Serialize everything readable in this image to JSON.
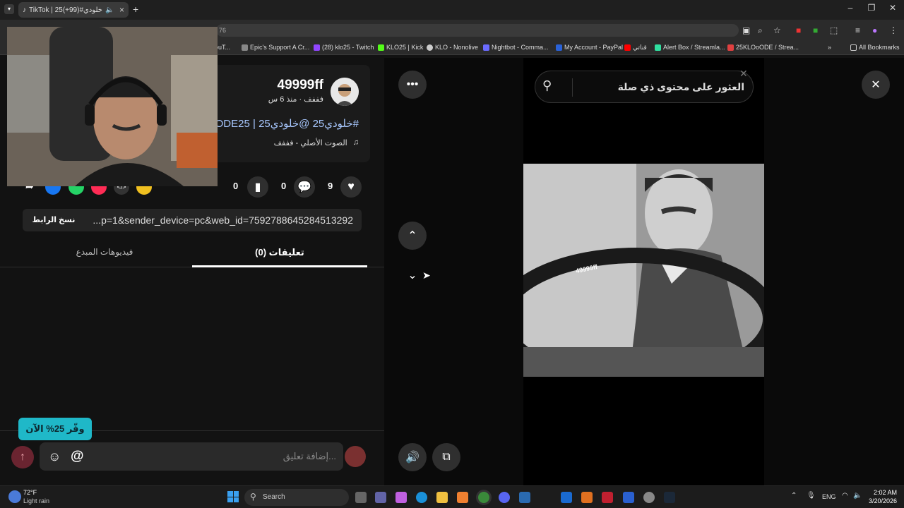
{
  "browser": {
    "tab_title": "TikTok | 25خلودي#(99+)",
    "tab_badge": "",
    "address_fragment": "76",
    "bookmarks": [
      {
        "label": "ouT...",
        "color": "#888"
      },
      {
        "label": "Epic's Support A Cr...",
        "color": "#888"
      },
      {
        "label": "(28) klo25 - Twitch",
        "color": "#9146ff"
      },
      {
        "label": "KLO25 | Kick",
        "color": "#53fc18"
      },
      {
        "label": "KLO - Nonolive",
        "color": "#ccc"
      },
      {
        "label": "Nightbot - Comma...",
        "color": "#6b6bff"
      },
      {
        "label": "My Account - PayPal",
        "color": "#2a62d8"
      },
      {
        "label": "قناتي",
        "color": "#ff0000"
      },
      {
        "label": "Alert Box / Streamla...",
        "color": "#30e0a0"
      },
      {
        "label": "25KLOoODE / Strea...",
        "color": "#e04040"
      }
    ],
    "all_bookmarks": "All Bookmarks"
  },
  "post": {
    "username": "49999ff",
    "meta": "فففف · منذ 6 س",
    "caption": "#خلودي25 @خلودي25 | ODE25",
    "sound": "الصوت الأصلي - فففف",
    "likes": "9",
    "comments": "0",
    "saves": "0",
    "link": "...p=1&sender_device=pc&web_id=7592788645284513292",
    "copy_link": "نسخ الرابط",
    "tab_comments": "(0) تعليقات",
    "tab_creator": "فيديوهات المبدع",
    "promo": "وفّر 25% الآن",
    "comment_placeholder": "إضافة تعليق...",
    "at_symbol": "@"
  },
  "video": {
    "search_placeholder": "العثور على محتوى ذي صلة",
    "watermark": "49999ff"
  },
  "taskbar": {
    "weather_temp": "72°F",
    "weather_desc": "Light rain",
    "search": "Search",
    "lang": "ENG",
    "time": "2:02 AM",
    "date": "3/20/2026"
  }
}
